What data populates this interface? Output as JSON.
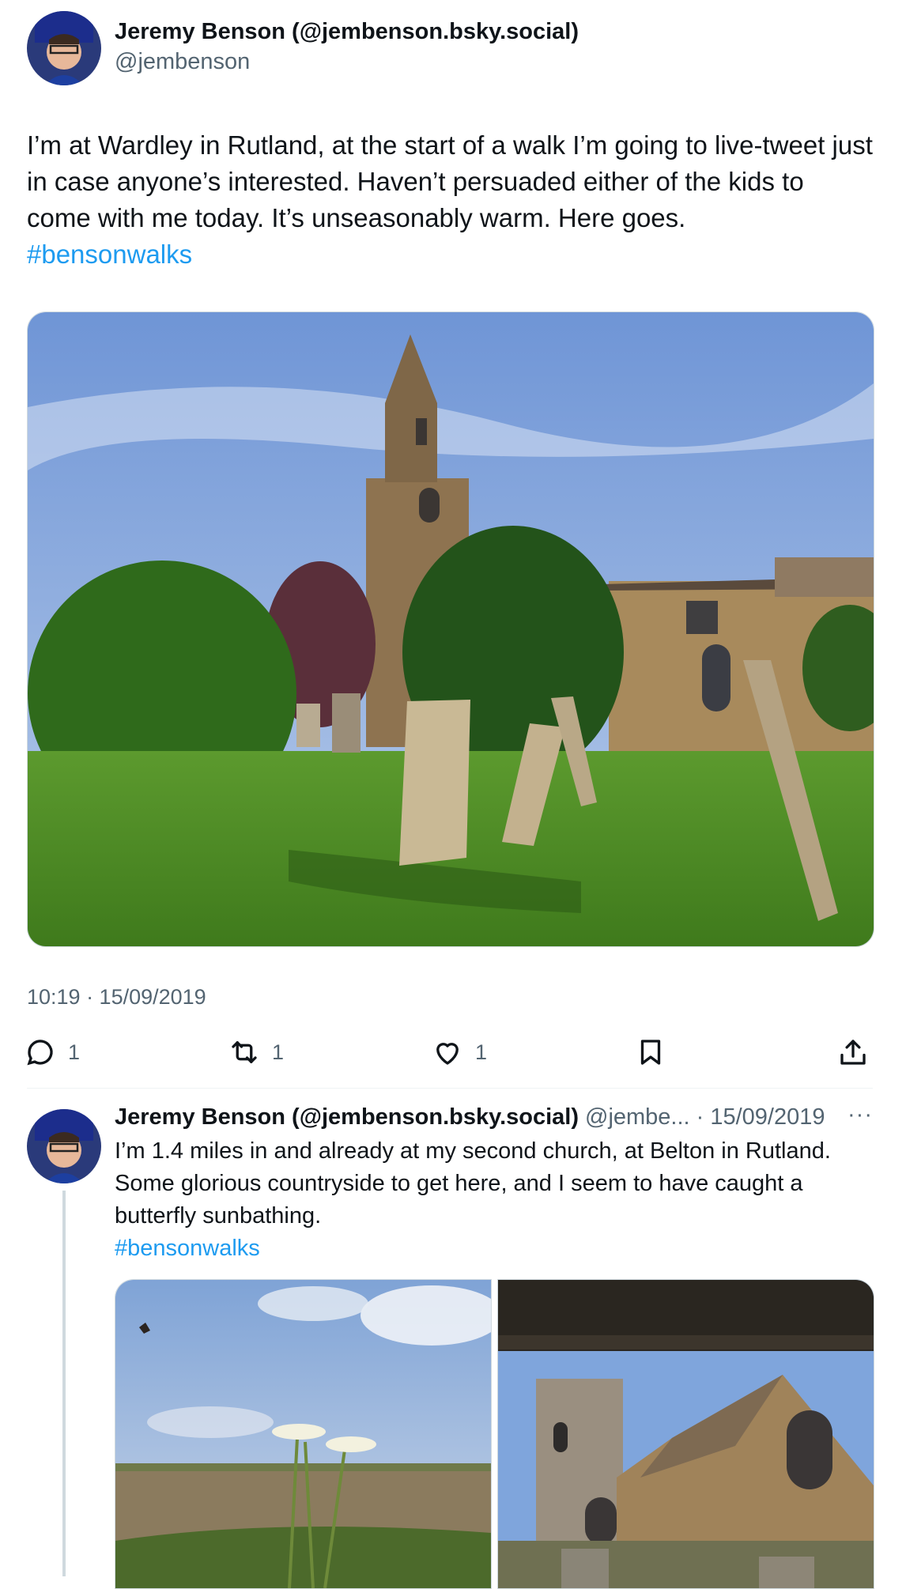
{
  "post": {
    "author_name": "Jeremy Benson (@jembenson.bsky.social)",
    "author_handle": "@jembenson",
    "text": "I’m at Wardley in Rutland, at the start of a walk I’m going to live-tweet just in case anyone’s interested. Haven’t persuaded either of the kids to come with me today. It’s unseasonably warm. Here goes.",
    "hashtag": "#bensonwalks",
    "timestamp": "10:19 · 15/09/2019",
    "actions": {
      "replies": "1",
      "reposts": "1",
      "likes": "1"
    }
  },
  "reply": {
    "author_name": "Jeremy Benson (@jembenson.bsky.social)",
    "author_handle_truncated": "@jembe...",
    "date": "· 15/09/2019",
    "more": "···",
    "text": "I’m 1.4 miles in and already at my second church, at Belton in Rutland. Some glorious countryside to get here, and I seem to have caught a butterfly sunbathing.",
    "hashtag": "#bensonwalks"
  },
  "icons": {
    "reply": "speech-bubble-icon",
    "repost": "repost-icon",
    "like": "heart-icon",
    "bookmark": "bookmark-icon",
    "share": "share-icon"
  },
  "colors": {
    "accent": "#1d9bf0",
    "secondary_text": "#536471",
    "thread_line": "#cfd9de"
  }
}
